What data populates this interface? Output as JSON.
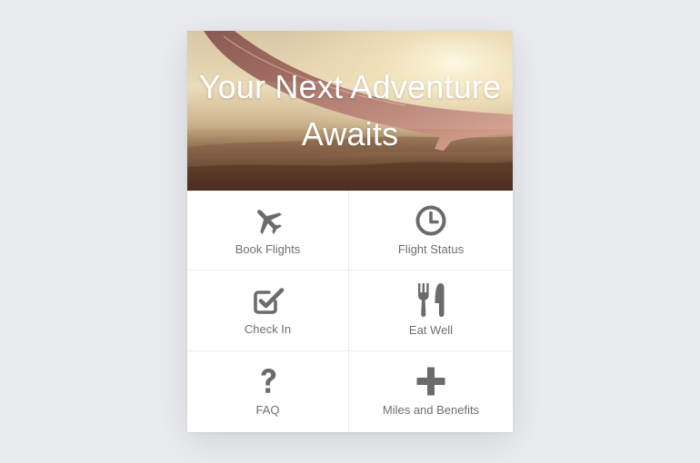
{
  "hero": {
    "title_line1": "Your Next Adventure",
    "title_line2": "Awaits"
  },
  "menu": [
    {
      "label": "Book Flights",
      "icon": "airplane-icon"
    },
    {
      "label": "Flight Status",
      "icon": "clock-icon"
    },
    {
      "label": "Check In",
      "icon": "checkbox-icon"
    },
    {
      "label": "Eat Well",
      "icon": "fork-knife-icon"
    },
    {
      "label": "FAQ",
      "icon": "question-mark-icon"
    },
    {
      "label": "Miles and Benefits",
      "icon": "plus-icon"
    }
  ],
  "colors": {
    "background": "#e9ebef",
    "card": "#ffffff",
    "icon": "#6b6b6b",
    "label": "#6f6f6f",
    "divider": "#ececec"
  }
}
